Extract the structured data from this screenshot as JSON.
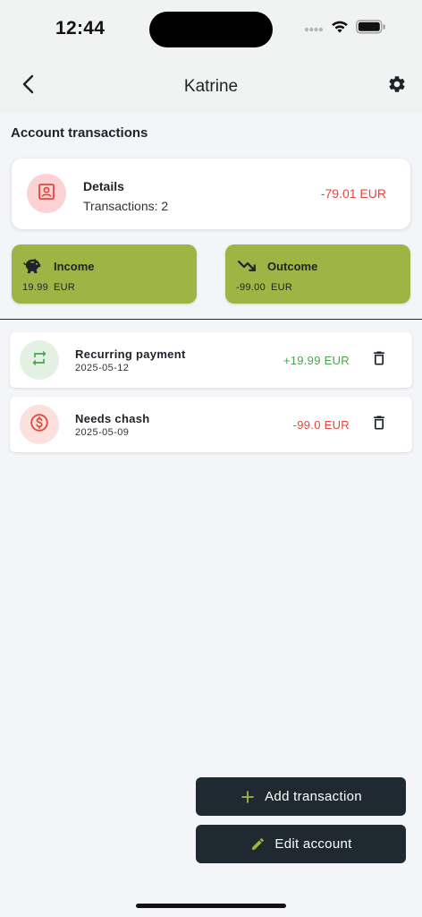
{
  "status_bar": {
    "time": "12:44"
  },
  "app_bar": {
    "title": "Katrine"
  },
  "section": {
    "title": "Account transactions"
  },
  "details": {
    "title": "Details",
    "transactions": "Transactions: 2",
    "amount": "-79.01 EUR"
  },
  "summary": {
    "income": {
      "label": "Income",
      "value": "19.99",
      "currency": "EUR"
    },
    "outcome": {
      "label": "Outcome",
      "value": "-99.00",
      "currency": "EUR"
    }
  },
  "transactions": [
    {
      "name": "Recurring payment",
      "date": "2025-05-12",
      "amount": "+19.99 EUR",
      "icon": "repeat-icon"
    },
    {
      "name": "Needs chash",
      "date": "2025-05-09",
      "amount": "-99.0 EUR",
      "icon": "dollar-circle-icon"
    }
  ],
  "actions": {
    "add_label": "Add transaction",
    "edit_label": "Edit account"
  },
  "colors": {
    "accent": "#a0b446",
    "dark_button": "#1e2a30",
    "positive": "#4aa54e",
    "negative": "#e2473d"
  }
}
